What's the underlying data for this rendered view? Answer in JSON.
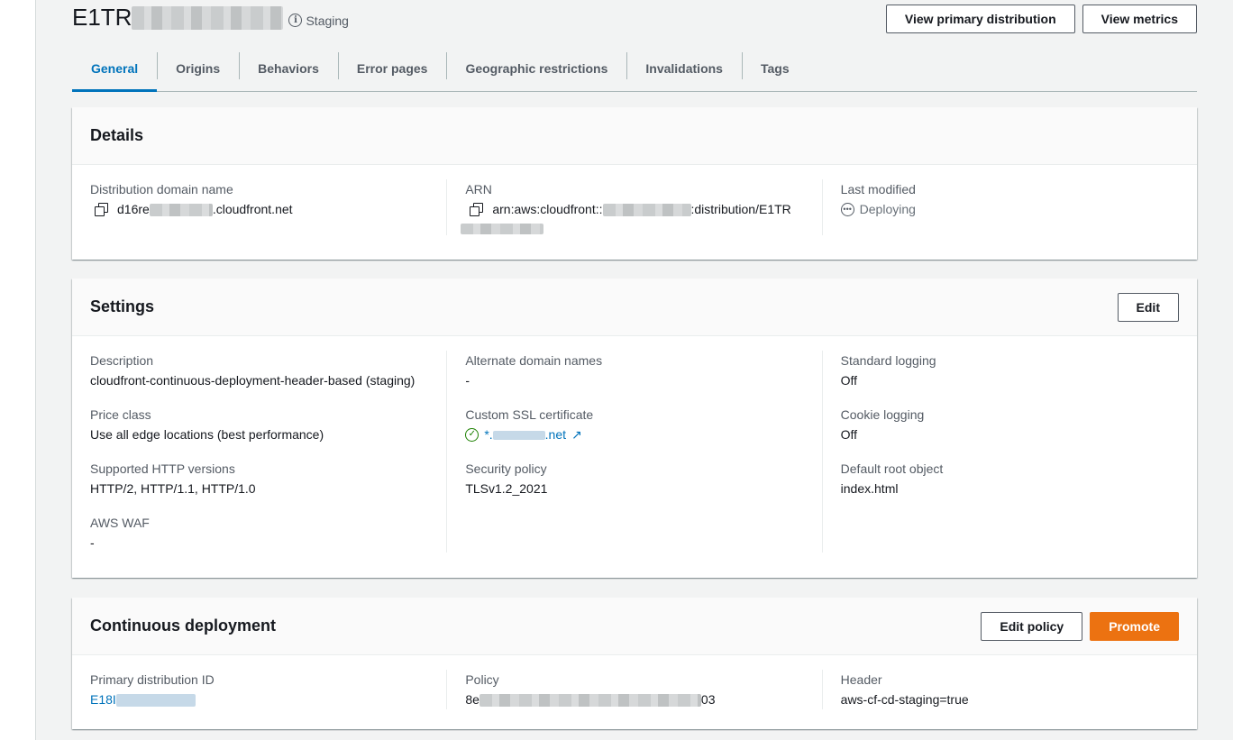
{
  "header": {
    "title_prefix": "E1TR",
    "status_label": "Staging",
    "buttons": {
      "primary_dist": "View primary distribution",
      "metrics": "View metrics"
    }
  },
  "tabs": [
    {
      "label": "General",
      "active": true
    },
    {
      "label": "Origins"
    },
    {
      "label": "Behaviors"
    },
    {
      "label": "Error pages"
    },
    {
      "label": "Geographic restrictions"
    },
    {
      "label": "Invalidations"
    },
    {
      "label": "Tags"
    }
  ],
  "details": {
    "title": "Details",
    "domain_label": "Distribution domain name",
    "domain_prefix": "d16re",
    "domain_suffix": ".cloudfront.net",
    "arn_label": "ARN",
    "arn_prefix": "arn:aws:cloudfront::",
    "arn_suffix": ":distribution/E1TR",
    "modified_label": "Last modified",
    "modified_value": "Deploying"
  },
  "settings": {
    "title": "Settings",
    "edit_label": "Edit",
    "description_label": "Description",
    "description_value": "cloudfront-continuous-deployment-header-based (staging)",
    "price_label": "Price class",
    "price_value": "Use all edge locations (best performance)",
    "http_label": "Supported HTTP versions",
    "http_value": "HTTP/2, HTTP/1.1, HTTP/1.0",
    "waf_label": "AWS WAF",
    "waf_value": "-",
    "alt_label": "Alternate domain names",
    "alt_value": "-",
    "ssl_label": "Custom SSL certificate",
    "ssl_prefix": "*.",
    "ssl_suffix": ".net",
    "security_label": "Security policy",
    "security_value": "TLSv1.2_2021",
    "logging_label": "Standard logging",
    "logging_value": "Off",
    "cookie_label": "Cookie logging",
    "cookie_value": "Off",
    "root_label": "Default root object",
    "root_value": "index.html"
  },
  "cd": {
    "title": "Continuous deployment",
    "edit_policy_label": "Edit policy",
    "promote_label": "Promote",
    "primary_label": "Primary distribution ID",
    "primary_prefix": "E18I",
    "policy_label": "Policy",
    "policy_prefix": "8e",
    "policy_suffix": "03",
    "header_label": "Header",
    "header_value": "aws-cf-cd-staging=true"
  },
  "colors": {
    "accent": "#0073bb",
    "promote": "#ec7211",
    "success": "#1d8102"
  },
  "icons": [
    "info-icon",
    "copy-icon",
    "pending-icon",
    "check-circle-icon",
    "external-link-icon"
  ]
}
